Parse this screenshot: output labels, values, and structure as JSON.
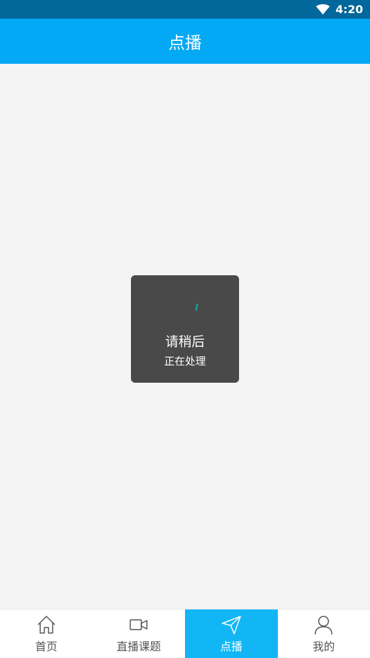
{
  "status_bar": {
    "time": "4:20",
    "wifi_icon": "wifi-icon"
  },
  "app_bar": {
    "title": "点播"
  },
  "loading_dialog": {
    "title": "请稍后",
    "message": "正在处理",
    "spinner_color": "#159a8e"
  },
  "tab_bar": {
    "active_color": "#12b6f5",
    "items": [
      {
        "label": "首页",
        "icon": "home-icon",
        "active": false
      },
      {
        "label": "直播课题",
        "icon": "video-camera-icon",
        "active": false
      },
      {
        "label": "点播",
        "icon": "paper-plane-icon",
        "active": true
      },
      {
        "label": "我的",
        "icon": "user-icon",
        "active": false
      }
    ]
  }
}
